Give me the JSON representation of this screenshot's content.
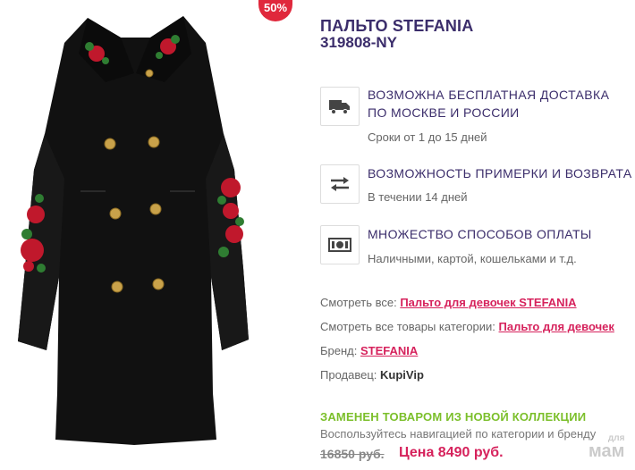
{
  "badge": {
    "discount": "50%"
  },
  "product": {
    "title": "ПАЛЬТО STEFANIA",
    "sku": "319808-NY",
    "image_alt": "black-coat-with-red-rose-embroidery"
  },
  "features": [
    {
      "icon": "delivery-truck-icon",
      "title_line1": "ВОЗМОЖНА БЕСПЛАТНАЯ ДОСТАВКА",
      "title_line2": "ПО МОСКВЕ И РОССИИ",
      "subtitle": "Сроки от 1 до 15 дней"
    },
    {
      "icon": "exchange-arrows-icon",
      "title_line1": "ВОЗМОЖНОСТЬ ПРИМЕРКИ И ВОЗВРАТА",
      "subtitle": "В течении 14 дней"
    },
    {
      "icon": "cash-icon",
      "title_line1": "МНОЖЕСТВО СПОСОБОВ ОПЛАТЫ",
      "subtitle": "Наличными, картой, кошельками и т.д."
    }
  ],
  "meta": {
    "see_all_label": "Смотреть все:",
    "see_all_link": "Пальто для девочек STEFANIA",
    "category_label": "Смотреть все товары категории:",
    "category_link": "Пальто для девочек",
    "brand_label": "Бренд:",
    "brand_link": "STEFANIA",
    "seller_label": "Продавец:",
    "seller_value": "KupiVip"
  },
  "status": {
    "replaced": "ЗАМЕНЕН ТОВАРОМ ИЗ НОВОЙ КОЛЛЕКЦИИ",
    "nav_hint": "Воспользуйтесь навигацией по категории и бренду"
  },
  "price": {
    "old": "16850 руб.",
    "new": "Цена 8490 руб."
  },
  "watermark": {
    "small": "для",
    "large": "мам"
  },
  "colors": {
    "brand_purple": "#3b2d6b",
    "link_pink": "#d6225c",
    "status_green": "#7bbf2a",
    "badge_red": "#e0283c"
  }
}
